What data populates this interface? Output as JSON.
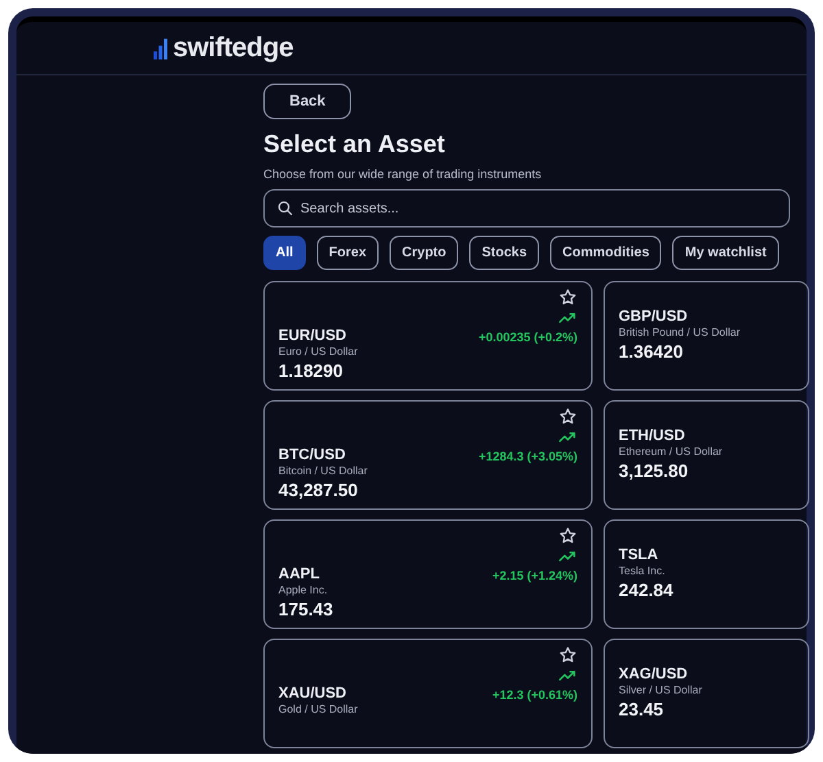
{
  "brand": {
    "name": "swiftedge"
  },
  "back_button": "Back",
  "title": "Select an Asset",
  "subtitle": "Choose from our wide range of trading instruments",
  "search": {
    "placeholder": "Search assets..."
  },
  "filters": [
    {
      "label": "All",
      "selected": true
    },
    {
      "label": "Forex",
      "selected": false
    },
    {
      "label": "Crypto",
      "selected": false
    },
    {
      "label": "Stocks",
      "selected": false
    },
    {
      "label": "Commodities",
      "selected": false
    },
    {
      "label": "My watchlist",
      "selected": false
    }
  ],
  "left_cards": [
    {
      "symbol": "EUR/USD",
      "name": "Euro / US Dollar",
      "price": "1.18290",
      "change": "+0.00235 (+0.2%)"
    },
    {
      "symbol": "BTC/USD",
      "name": "Bitcoin / US Dollar",
      "price": "43,287.50",
      "change": "+1284.3 (+3.05%)"
    },
    {
      "symbol": "AAPL",
      "name": "Apple Inc.",
      "price": "175.43",
      "change": "+2.15 (+1.24%)"
    },
    {
      "symbol": "XAU/USD",
      "name": "Gold / US Dollar",
      "change": "+12.3 (+0.61%)"
    }
  ],
  "right_cards": [
    {
      "symbol": "GBP/USD",
      "name": "British Pound / US Dollar",
      "price": "1.36420"
    },
    {
      "symbol": "ETH/USD",
      "name": "Ethereum / US Dollar",
      "price": "3,125.80"
    },
    {
      "symbol": "TSLA",
      "name": "Tesla Inc.",
      "price": "242.84"
    },
    {
      "symbol": "XAG/USD",
      "name": "Silver / US Dollar",
      "price": "23.45"
    }
  ]
}
